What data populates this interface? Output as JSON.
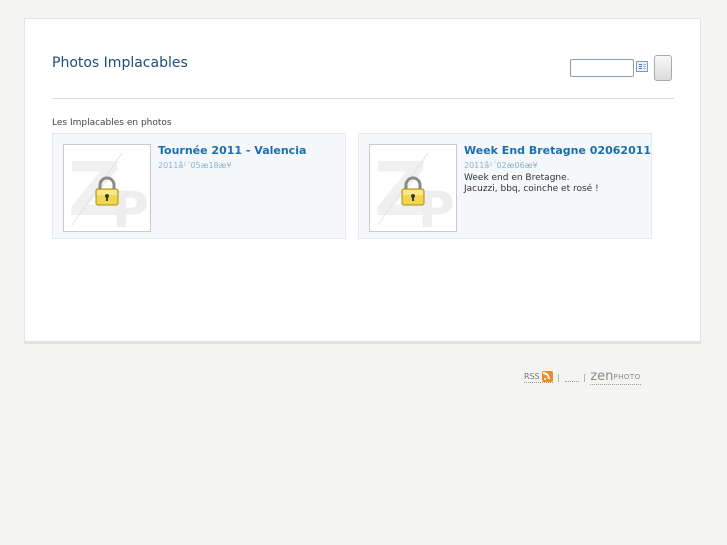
{
  "header": {
    "site_title": "Photos Implacables"
  },
  "search": {
    "value": "",
    "placeholder": ""
  },
  "gallery": {
    "section_heading": "Les Implacables en photos",
    "albums": [
      {
        "title": "Tournée 2011 - Valencia",
        "date": "2011å¹´05æ18æ¥",
        "description_lines": [],
        "locked": true
      },
      {
        "title": "Week End Bretagne 02062011",
        "date": "2011å¹´02æ06æ¥",
        "description_lines": [
          "Week end en Bretagne.",
          "Jacuzzi, bbq, coinche et rosé !"
        ],
        "locked": true
      }
    ]
  },
  "footer": {
    "rss_label": "RSS",
    "separator": "|",
    "logo_zen": "zen",
    "logo_photo": "PHOTO"
  },
  "colors": {
    "title_blue": "#1e4d78",
    "link_blue": "#1a6fad",
    "date_blue": "#8ab2d0",
    "rss_orange": "#f08a24",
    "lock_yellow": "#f2d64b"
  },
  "icons": {
    "search_options": "search-options-icon",
    "lock": "lock-icon",
    "rss": "rss-icon"
  }
}
